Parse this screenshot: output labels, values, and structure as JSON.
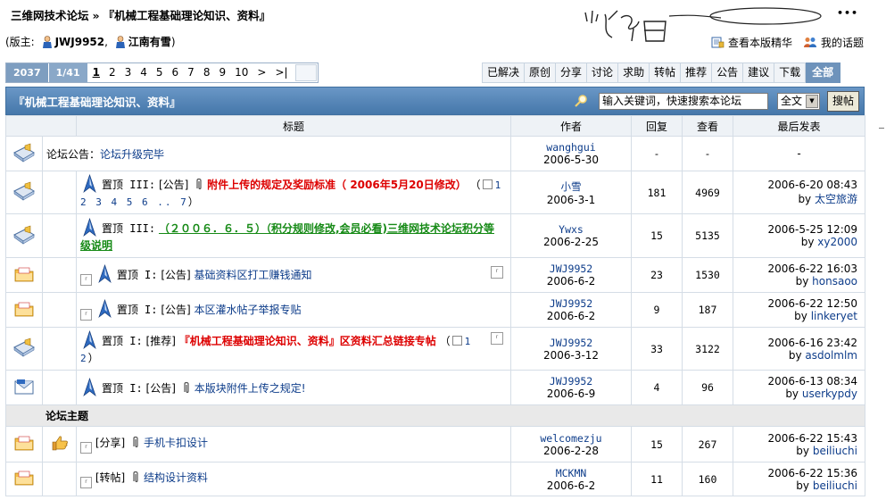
{
  "breadcrumb": {
    "site": "三维网技术论坛",
    "separator": "»",
    "forum": "『机械工程基础理论知识、资料』"
  },
  "moderators": {
    "prefix": "(版主:",
    "names": [
      "JWJ9952",
      "江南有雪"
    ],
    "comma": ",",
    "suffix": ")"
  },
  "header_links": {
    "view_best": "查看本版精华",
    "my_topics": "我的话题",
    "more": "•••"
  },
  "pager": {
    "total_label": "2037",
    "page_of": "1/41",
    "pages": [
      "1",
      "2",
      "3",
      "4",
      "5",
      "6",
      "7",
      "8",
      "9",
      "10"
    ],
    "next": ">",
    "last": ">|",
    "current": "1"
  },
  "categories": [
    "已解决",
    "原创",
    "分享",
    "讨论",
    "求助",
    "转帖",
    "推荐",
    "公告",
    "建议",
    "下载",
    "全部"
  ],
  "forum_header": {
    "title": "『机械工程基础理论知识、资料』",
    "search_placeholder": "输入关键词，快速搜索本论坛",
    "scope": "全文",
    "search_button": "搜帖"
  },
  "columns": {
    "title": "标题",
    "author": "作者",
    "replies": "回复",
    "views": "查看",
    "last_post": "最后发表"
  },
  "announcement": {
    "label": "论坛公告：",
    "title": "论坛升级完毕",
    "author": "wanghgui",
    "date": "2006-5-30",
    "replies": "-",
    "views": "-",
    "last": "-"
  },
  "pinned": [
    {
      "level": "置顶 III:",
      "tag": "[公告]",
      "title": "附件上传的规定及奖励标准（ 2006年5月20日修改）",
      "pages": "1 2 3 4 5 6 .. 7",
      "author": "小雪",
      "date": "2006-3-1",
      "replies": "181",
      "views": "4969",
      "last_date": "2006-6-20 08:43",
      "last_by_prefix": "by",
      "last_by": "太空旅游"
    },
    {
      "level": "置顶 III:",
      "tag": "",
      "title": "（２００６．６．５）（积分规则修改,会员必看)三维网技术论坛积分等级说明",
      "author": "Ywxs",
      "date": "2006-2-25",
      "replies": "15",
      "views": "5135",
      "last_date": "2006-5-25 12:09",
      "last_by_prefix": "by",
      "last_by": "xy2000"
    },
    {
      "level": "置顶 I:",
      "tag": "[公告]",
      "title": "基础资料区打工赚钱通知",
      "author": "JWJ9952",
      "date": "2006-6-2",
      "replies": "23",
      "views": "1530",
      "last_date": "2006-6-22 16:03",
      "last_by_prefix": "by",
      "last_by": "honsaoo"
    },
    {
      "level": "置顶 I:",
      "tag": "[公告]",
      "title": "本区灌水帖子举报专贴",
      "author": "JWJ9952",
      "date": "2006-6-2",
      "replies": "9",
      "views": "187",
      "last_date": "2006-6-22 12:50",
      "last_by_prefix": "by",
      "last_by": "linkeryet"
    },
    {
      "level": "置顶 I:",
      "tag": "[推荐]",
      "title": "『机械工程基础理论知识、资料』区资料汇总链接专帖",
      "pages": "1 2",
      "author": "JWJ9952",
      "date": "2006-3-12",
      "replies": "33",
      "views": "3122",
      "last_date": "2006-6-16 23:42",
      "last_by_prefix": "by",
      "last_by": "asdolmlm"
    },
    {
      "level": "置顶 I:",
      "tag": "[公告]",
      "title": "本版块附件上传之规定!",
      "author": "JWJ9952",
      "date": "2006-6-9",
      "replies": "4",
      "views": "96",
      "last_date": "2006-6-13 08:34",
      "last_by_prefix": "by",
      "last_by": "userkypdy"
    }
  ],
  "section_title": "论坛主题",
  "threads": [
    {
      "tag": "[分享]",
      "title": "手机卡扣设计",
      "author": "welcomezju",
      "date": "2006-2-28",
      "replies": "15",
      "views": "267",
      "last_date": "2006-6-22 15:43",
      "last_by_prefix": "by",
      "last_by": "beiliuchi"
    },
    {
      "tag": "[转帖]",
      "title": "结构设计资料",
      "author": "MCKMN",
      "date": "2006-6-2",
      "replies": "11",
      "views": "160",
      "last_date": "2006-6-22 15:36",
      "last_by_prefix": "by",
      "last_by": "beiliuchi"
    }
  ],
  "colors": {
    "header_blue": "#5283b6",
    "link_blue": "#0d3c8a",
    "hot_red": "#dd0000",
    "hot_green": "#168a16"
  },
  "icons": [
    "moderator-icon",
    "envelope-loudspeaker-icon",
    "folder-icon",
    "pin-icon",
    "paperclip-icon",
    "thumbs-up-icon",
    "search-icon"
  ]
}
